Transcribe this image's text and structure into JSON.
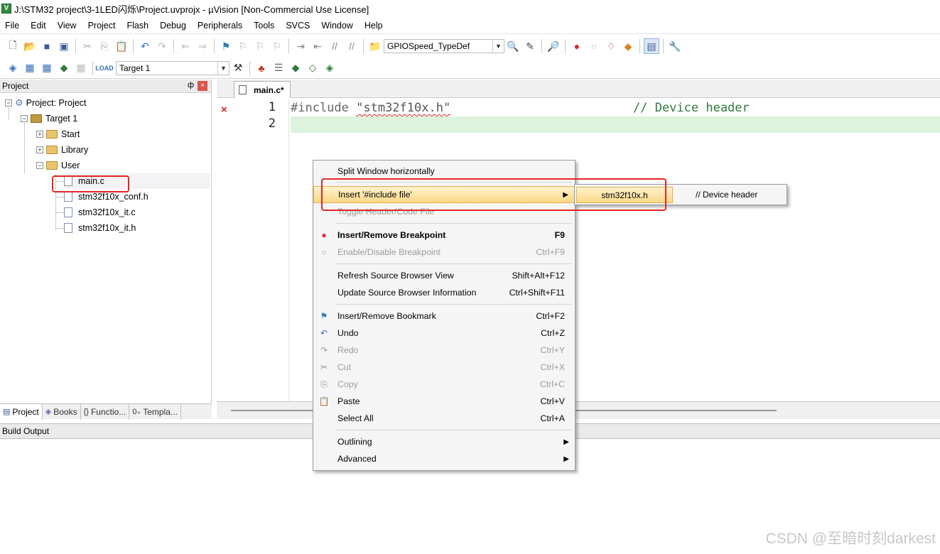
{
  "window": {
    "title": "J:\\STM32 project\\3-1LED闪烁\\Project.uvprojx - µVision  [Non-Commercial Use License]",
    "app_icon_letter": "V"
  },
  "menubar": [
    "File",
    "Edit",
    "View",
    "Project",
    "Flash",
    "Debug",
    "Peripherals",
    "Tools",
    "SVCS",
    "Window",
    "Help"
  ],
  "toolbar1": {
    "combo_value": "GPIOSpeed_TypeDef"
  },
  "toolbar2": {
    "target_combo": "Target 1"
  },
  "project_pane": {
    "header": "Project",
    "pin": "ф",
    "close": "×",
    "tree": {
      "root": "Project: Project",
      "target": "Target 1",
      "groups": [
        "Start",
        "Library",
        "User"
      ],
      "files": [
        "main.c",
        "stm32f10x_conf.h",
        "stm32f10x_it.c",
        "stm32f10x_it.h"
      ],
      "expand_plus": "+",
      "expand_minus": "−"
    },
    "tabs": [
      {
        "label": "Project",
        "icon": "▤"
      },
      {
        "label": "Books",
        "icon": "◈"
      },
      {
        "label": "Functio...",
        "icon": "{}"
      },
      {
        "label": "Templa...",
        "icon": "0₊"
      }
    ]
  },
  "editor": {
    "tab": "main.c*",
    "error_mark": "×",
    "line_numbers": [
      "1",
      "2"
    ],
    "code": {
      "line1_include": "#include ",
      "line1_file": "\"stm32f10x.h\"",
      "line1_comment": "// Device header",
      "line2": ""
    }
  },
  "build_output": "Build Output",
  "context_menu": {
    "items": [
      {
        "label": "Split Window horizontally",
        "shortcut": ""
      },
      {
        "label": "Insert '#include file'",
        "shortcut": ""
      },
      {
        "label": "Toggle Header/Code File",
        "shortcut": ""
      },
      {
        "label": "Insert/Remove Breakpoint",
        "shortcut": "F9"
      },
      {
        "label": "Enable/Disable Breakpoint",
        "shortcut": "Ctrl+F9"
      },
      {
        "label": "Refresh Source Browser View",
        "shortcut": "Shift+Alt+F12"
      },
      {
        "label": "Update Source Browser Information",
        "shortcut": "Ctrl+Shift+F11"
      },
      {
        "label": "Insert/Remove Bookmark",
        "shortcut": "Ctrl+F2"
      },
      {
        "label": "Undo",
        "shortcut": "Ctrl+Z"
      },
      {
        "label": "Redo",
        "shortcut": "Ctrl+Y"
      },
      {
        "label": "Cut",
        "shortcut": "Ctrl+X"
      },
      {
        "label": "Copy",
        "shortcut": "Ctrl+C"
      },
      {
        "label": "Paste",
        "shortcut": "Ctrl+V"
      },
      {
        "label": "Select All",
        "shortcut": "Ctrl+A"
      },
      {
        "label": "Outlining",
        "shortcut": ""
      },
      {
        "label": "Advanced",
        "shortcut": ""
      }
    ],
    "submenu": {
      "file": "stm32f10x.h",
      "comment": "// Device header"
    }
  },
  "watermark": "CSDN @至暗时刻darkest",
  "colors": {
    "highlight_red": "#e32626",
    "menu_highlight": "#fbd889",
    "line2_bg": "#ddf3dd",
    "comment_green": "#2f7a3c"
  }
}
